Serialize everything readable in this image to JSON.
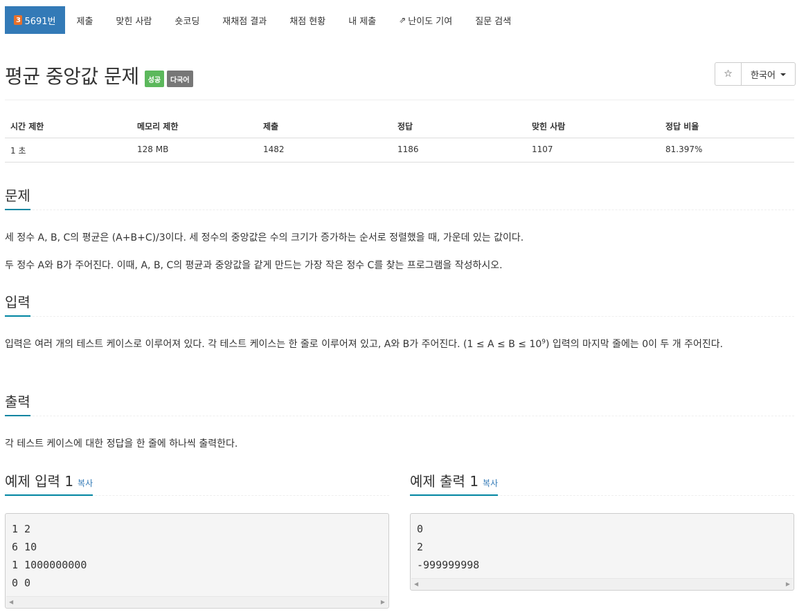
{
  "nav": {
    "problem_number": "5691번",
    "tier": "3",
    "items": [
      "제출",
      "맞힌 사람",
      "숏코딩",
      "재채점 결과",
      "채점 현황",
      "내 제출",
      "난이도 기여",
      "질문 검색"
    ]
  },
  "problem": {
    "title": "평균 중앙값 문제",
    "labels": [
      "성공",
      "다국어"
    ]
  },
  "toolbar": {
    "star": "☆",
    "language": "한국어"
  },
  "info_table": {
    "headers": [
      "시간 제한",
      "메모리 제한",
      "제출",
      "정답",
      "맞힌 사람",
      "정답 비율"
    ],
    "values": [
      "1 초",
      "128 MB",
      "1482",
      "1186",
      "1107",
      "81.397%"
    ]
  },
  "sections": {
    "description": {
      "heading": "문제",
      "paragraphs": [
        "세 정수 A, B, C의 평균은 (A+B+C)/3이다. 세 정수의 중앙값은 수의 크기가 증가하는 순서로 정렬했을 때, 가운데 있는 값이다.",
        "두 정수 A와 B가 주어진다. 이때, A, B, C의 평균과 중앙값을 같게 만드는 가장 작은 정수 C를 찾는 프로그램을 작성하시오."
      ]
    },
    "input": {
      "heading": "입력",
      "text_before": "입력은 여러 개의 테스트 케이스로 이루어져 있다. 각 테스트 케이스는 한 줄로 이루어져 있고, A와 B가 주어진다. (1 ≤ A ≤ B ≤ 10",
      "exponent": "9",
      "text_after": ") 입력의 마지막 줄에는 0이 두 개 주어진다."
    },
    "output": {
      "heading": "출력",
      "text": "각 테스트 케이스에 대한 정답을 한 줄에 하나씩 출력한다."
    }
  },
  "samples": {
    "input": {
      "heading": "예제 입력 1",
      "copy": "복사",
      "content": "1 2\n6 10\n1 1000000000\n0 0"
    },
    "output": {
      "heading": "예제 출력 1",
      "copy": "복사",
      "content": "0\n2\n-999999998"
    }
  },
  "colors": {
    "nav_active": "#337ab7",
    "label_success": "#5cb85c",
    "label_default": "#777777",
    "headline_underline": "#0085a1",
    "tier_badge": "#e8702a"
  }
}
